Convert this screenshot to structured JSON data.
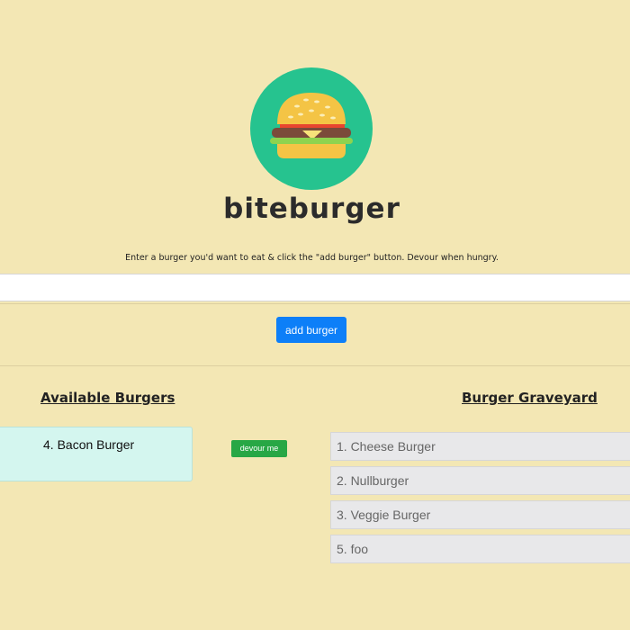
{
  "brand": {
    "name": "biteburger"
  },
  "instructions": "Enter a burger you'd want to eat & click the \"add burger\" button. Devour when hungry.",
  "form": {
    "input_value": "",
    "add_label": "add burger"
  },
  "available": {
    "heading": "Available Burgers",
    "items": [
      {
        "label": "4. Bacon Burger",
        "action_label": "devour me"
      }
    ]
  },
  "graveyard": {
    "heading": "Burger Graveyard",
    "items": [
      {
        "label": "1. Cheese Burger"
      },
      {
        "label": "2. Nullburger"
      },
      {
        "label": "3. Veggie Burger"
      },
      {
        "label": "5. foo"
      }
    ]
  },
  "colors": {
    "background": "#f3e7b4",
    "logo_circle": "#26c38f",
    "primary_button": "#0d7ff8",
    "success_button": "#28a745",
    "available_card": "#d4f6ef",
    "graveyard_item": "#e8e8ea"
  },
  "icons": {
    "logo": "burger-icon"
  }
}
